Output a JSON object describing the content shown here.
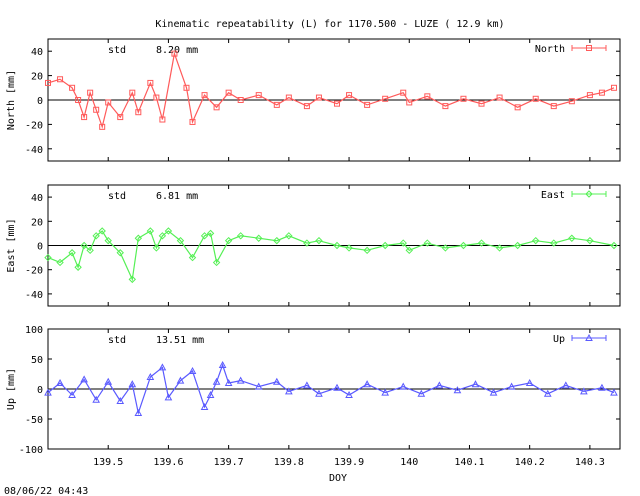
{
  "chart_data": {
    "title": "Kinematic repeatability (L) for 1170.500 - LUZE  ( 12.9 km)",
    "xlabel": "DOY",
    "xlim": [
      139.4,
      140.35
    ],
    "xticks": [
      "139.5",
      "139.6",
      "139.7",
      "139.8",
      "139.9",
      "140",
      "140.1",
      "140.2",
      "140.3"
    ],
    "timestamp": "08/06/22 04:43",
    "panels": [
      {
        "type": "scatter",
        "name": "North",
        "ylabel": "North [mm]",
        "std_label": "std",
        "std_value": "8.20 mm",
        "ylim": [
          -50,
          50
        ],
        "yticks": [
          "40",
          "20",
          "0",
          "-20",
          "-40"
        ],
        "color": "#ff5a5a",
        "marker": "square",
        "series": [
          [
            139.4,
            14
          ],
          [
            139.42,
            17
          ],
          [
            139.44,
            10
          ],
          [
            139.45,
            0
          ],
          [
            139.46,
            -14
          ],
          [
            139.47,
            6
          ],
          [
            139.48,
            -8
          ],
          [
            139.49,
            -22
          ],
          [
            139.5,
            -2
          ],
          [
            139.52,
            -14
          ],
          [
            139.54,
            6
          ],
          [
            139.55,
            -10
          ],
          [
            139.57,
            14
          ],
          [
            139.58,
            2
          ],
          [
            139.59,
            -16
          ],
          [
            139.61,
            38
          ],
          [
            139.63,
            10
          ],
          [
            139.64,
            -18
          ],
          [
            139.66,
            4
          ],
          [
            139.68,
            -6
          ],
          [
            139.7,
            6
          ],
          [
            139.72,
            0
          ],
          [
            139.75,
            4
          ],
          [
            139.78,
            -4
          ],
          [
            139.8,
            2
          ],
          [
            139.83,
            -5
          ],
          [
            139.85,
            2
          ],
          [
            139.88,
            -3
          ],
          [
            139.9,
            4
          ],
          [
            139.93,
            -4
          ],
          [
            139.96,
            1
          ],
          [
            139.99,
            6
          ],
          [
            140.0,
            -2
          ],
          [
            140.03,
            3
          ],
          [
            140.06,
            -5
          ],
          [
            140.09,
            1
          ],
          [
            140.12,
            -3
          ],
          [
            140.15,
            2
          ],
          [
            140.18,
            -6
          ],
          [
            140.21,
            1
          ],
          [
            140.24,
            -5
          ],
          [
            140.27,
            -1
          ],
          [
            140.3,
            4
          ],
          [
            140.32,
            6
          ],
          [
            140.34,
            10
          ]
        ]
      },
      {
        "type": "scatter",
        "name": "East",
        "ylabel": "East [mm]",
        "std_label": "std",
        "std_value": "6.81 mm",
        "ylim": [
          -50,
          50
        ],
        "yticks": [
          "40",
          "20",
          "0",
          "-20",
          "-40"
        ],
        "color": "#55f055",
        "marker": "diamond",
        "series": [
          [
            139.4,
            -10
          ],
          [
            139.42,
            -14
          ],
          [
            139.44,
            -6
          ],
          [
            139.45,
            -18
          ],
          [
            139.46,
            0
          ],
          [
            139.47,
            -4
          ],
          [
            139.48,
            8
          ],
          [
            139.49,
            12
          ],
          [
            139.5,
            4
          ],
          [
            139.52,
            -6
          ],
          [
            139.54,
            -28
          ],
          [
            139.55,
            6
          ],
          [
            139.57,
            12
          ],
          [
            139.58,
            -2
          ],
          [
            139.59,
            8
          ],
          [
            139.6,
            12
          ],
          [
            139.62,
            4
          ],
          [
            139.64,
            -10
          ],
          [
            139.66,
            8
          ],
          [
            139.67,
            10
          ],
          [
            139.68,
            -14
          ],
          [
            139.7,
            4
          ],
          [
            139.72,
            8
          ],
          [
            139.75,
            6
          ],
          [
            139.78,
            4
          ],
          [
            139.8,
            8
          ],
          [
            139.83,
            2
          ],
          [
            139.85,
            4
          ],
          [
            139.88,
            0
          ],
          [
            139.9,
            -2
          ],
          [
            139.93,
            -4
          ],
          [
            139.96,
            0
          ],
          [
            139.99,
            2
          ],
          [
            140.0,
            -4
          ],
          [
            140.03,
            2
          ],
          [
            140.06,
            -2
          ],
          [
            140.09,
            0
          ],
          [
            140.12,
            2
          ],
          [
            140.15,
            -2
          ],
          [
            140.18,
            0
          ],
          [
            140.21,
            4
          ],
          [
            140.24,
            2
          ],
          [
            140.27,
            6
          ],
          [
            140.3,
            4
          ],
          [
            140.34,
            0
          ]
        ]
      },
      {
        "type": "scatter",
        "name": "Up",
        "ylabel": "Up [mm]",
        "std_label": "std",
        "std_value": "13.51 mm",
        "ylim": [
          -100,
          100
        ],
        "yticks": [
          "100",
          "50",
          "0",
          "-50",
          "-100"
        ],
        "color": "#5a5aff",
        "marker": "triangle",
        "series": [
          [
            139.4,
            -6
          ],
          [
            139.42,
            10
          ],
          [
            139.44,
            -10
          ],
          [
            139.46,
            16
          ],
          [
            139.48,
            -18
          ],
          [
            139.5,
            12
          ],
          [
            139.52,
            -20
          ],
          [
            139.54,
            8
          ],
          [
            139.55,
            -40
          ],
          [
            139.57,
            20
          ],
          [
            139.59,
            36
          ],
          [
            139.6,
            -14
          ],
          [
            139.62,
            14
          ],
          [
            139.64,
            30
          ],
          [
            139.66,
            -30
          ],
          [
            139.67,
            -10
          ],
          [
            139.68,
            12
          ],
          [
            139.69,
            40
          ],
          [
            139.7,
            10
          ],
          [
            139.72,
            14
          ],
          [
            139.75,
            4
          ],
          [
            139.78,
            12
          ],
          [
            139.8,
            -4
          ],
          [
            139.83,
            6
          ],
          [
            139.85,
            -8
          ],
          [
            139.88,
            2
          ],
          [
            139.9,
            -10
          ],
          [
            139.93,
            8
          ],
          [
            139.96,
            -6
          ],
          [
            139.99,
            4
          ],
          [
            140.02,
            -8
          ],
          [
            140.05,
            6
          ],
          [
            140.08,
            -2
          ],
          [
            140.11,
            8
          ],
          [
            140.14,
            -6
          ],
          [
            140.17,
            4
          ],
          [
            140.2,
            10
          ],
          [
            140.23,
            -8
          ],
          [
            140.26,
            6
          ],
          [
            140.29,
            -4
          ],
          [
            140.32,
            2
          ],
          [
            140.34,
            -6
          ]
        ]
      }
    ]
  }
}
